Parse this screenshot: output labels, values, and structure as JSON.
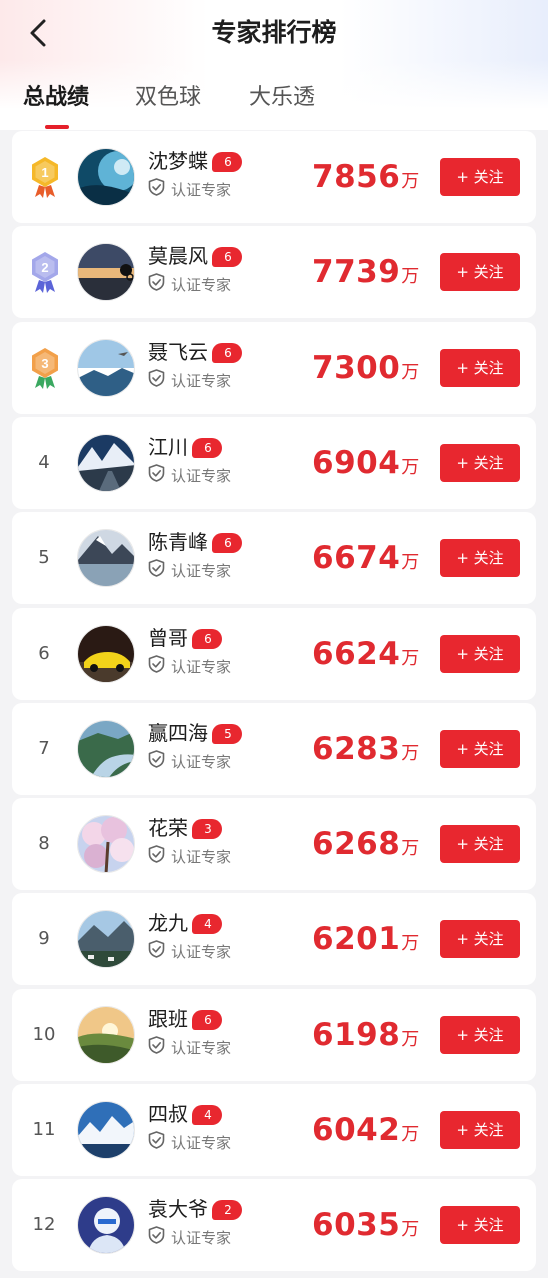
{
  "header": {
    "title": "专家排行榜"
  },
  "tabs": [
    {
      "label": "总战绩",
      "active": true
    },
    {
      "label": "双色球",
      "active": false
    },
    {
      "label": "大乐透",
      "active": false
    }
  ],
  "colors": {
    "accent": "#e8272f",
    "amount": "#e02a30",
    "gold": "#f5b829",
    "silver": "#a3a7ea",
    "bronze": "#f2a04a"
  },
  "unit": "万",
  "follow_label": "+ 关注",
  "verify_label": "认证专家",
  "experts": [
    {
      "rank": "1",
      "medal": "gold",
      "name": "沈梦蝶",
      "level": "6",
      "amount": "7856",
      "avatar": "avatar-blue-abstract"
    },
    {
      "rank": "2",
      "medal": "silver",
      "name": "莫晨风",
      "level": "6",
      "amount": "7739",
      "avatar": "avatar-sunset-cyclist"
    },
    {
      "rank": "3",
      "medal": "bronze",
      "name": "聂飞云",
      "level": "6",
      "amount": "7300",
      "avatar": "avatar-cloud-sea"
    },
    {
      "rank": "4",
      "medal": "",
      "name": "江川",
      "level": "6",
      "amount": "6904",
      "avatar": "avatar-mountain-road"
    },
    {
      "rank": "5",
      "medal": "",
      "name": "陈青峰",
      "level": "6",
      "amount": "6674",
      "avatar": "avatar-mountain-lake"
    },
    {
      "rank": "6",
      "medal": "",
      "name": "曾哥",
      "level": "6",
      "amount": "6624",
      "avatar": "avatar-yellow-car"
    },
    {
      "rank": "7",
      "medal": "",
      "name": "赢四海",
      "level": "5",
      "amount": "6283",
      "avatar": "avatar-river-valley"
    },
    {
      "rank": "8",
      "medal": "",
      "name": "花荣",
      "level": "3",
      "amount": "6268",
      "avatar": "avatar-blossom"
    },
    {
      "rank": "9",
      "medal": "",
      "name": "龙九",
      "level": "4",
      "amount": "6201",
      "avatar": "avatar-valley-village"
    },
    {
      "rank": "10",
      "medal": "",
      "name": "跟班",
      "level": "6",
      "amount": "6198",
      "avatar": "avatar-sunrise-hills"
    },
    {
      "rank": "11",
      "medal": "",
      "name": "四叔",
      "level": "4",
      "amount": "6042",
      "avatar": "avatar-snow-peaks"
    },
    {
      "rank": "12",
      "medal": "",
      "name": "袁大爷",
      "level": "2",
      "amount": "6035",
      "avatar": "avatar-cartoon-man"
    }
  ]
}
